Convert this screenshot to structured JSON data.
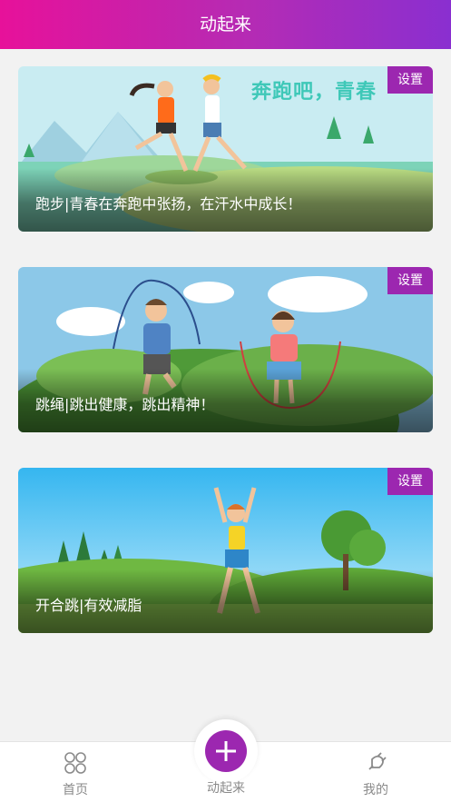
{
  "header": {
    "title": "动起来"
  },
  "cards": [
    {
      "caption": "跑步|青春在奔跑中张扬，在汗水中成长！",
      "settings_label": "设置",
      "banner_text": "奔跑吧，青春"
    },
    {
      "caption": "跳绳|跳出健康，跳出精神！",
      "settings_label": "设置"
    },
    {
      "caption": "开合跳|有效减脂",
      "settings_label": "设置"
    }
  ],
  "tabbar": {
    "home": {
      "label": "首页",
      "icon": "home-grid-icon"
    },
    "center": {
      "label": "动起来",
      "icon": "plus-icon"
    },
    "mine": {
      "label": "我的",
      "icon": "plug-icon"
    }
  },
  "colors": {
    "header_start": "#e7119a",
    "header_end": "#8a2fd0",
    "accent": "#9c27b0",
    "background": "#f2f2f2"
  }
}
